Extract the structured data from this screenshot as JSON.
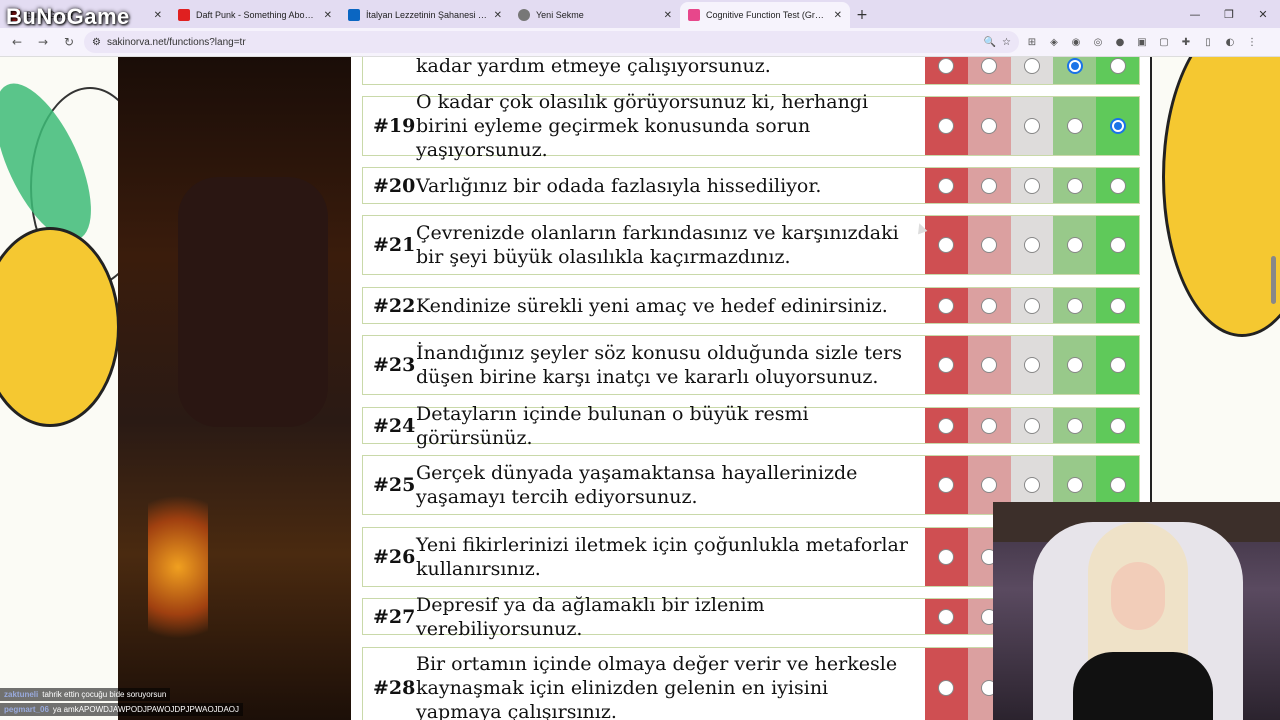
{
  "browser": {
    "tabs": [
      {
        "title": "BuNoGame",
        "favicon_color": "#e02020",
        "active": false
      },
      {
        "title": "Daft Punk - Something About Us",
        "favicon_color": "#e02020",
        "active": false
      },
      {
        "title": "İtalyan Lezzetinin Şahanesi Tiramisu",
        "favicon_color": "#0a66c2",
        "active": false
      },
      {
        "title": "Yeni Sekme",
        "favicon_color": "#777777",
        "active": false
      },
      {
        "title": "Cognitive Function Test (Grant/Bro",
        "favicon_color": "#e7478b",
        "active": true
      }
    ],
    "new_tab": "+",
    "url": "sakinorva.net/functions?lang=tr"
  },
  "overlay": {
    "logo": "BuNoGame",
    "chat": [
      {
        "user": "zaktuneli",
        "message": "tahrik ettin çocuğu bide soruyorsun"
      },
      {
        "user": "pegmart_06",
        "message": "ya amkAPOWDJAWPODJPAWOJDPJPWAOJDAOJ"
      }
    ]
  },
  "questions": [
    {
      "number": "",
      "text": "kadar yardım etmeye çalışıyorsunuz.",
      "selected": 4
    },
    {
      "number": "#19",
      "text": "O kadar çok olasılık görüyorsunuz ki, herhangi birini eyleme geçirmek konusunda sorun yaşıyorsunuz.",
      "selected": 5
    },
    {
      "number": "#20",
      "text": "Varlığınız bir odada fazlasıyla hissediliyor.",
      "selected": 0
    },
    {
      "number": "#21",
      "text": "Çevrenizde olanların farkındasınız ve karşınızdaki bir şeyi büyük olasılıkla kaçırmazdınız.",
      "selected": 0
    },
    {
      "number": "#22",
      "text": "Kendinize sürekli yeni amaç ve hedef edinirsiniz.",
      "selected": 0
    },
    {
      "number": "#23",
      "text": "İnandığınız şeyler söz konusu olduğunda sizle ters düşen birine karşı inatçı ve kararlı oluyorsunuz.",
      "selected": 0
    },
    {
      "number": "#24",
      "text": "Detayların içinde bulunan o büyük resmi görürsünüz.",
      "selected": 0
    },
    {
      "number": "#25",
      "text": "Gerçek dünyada yaşamaktansa hayallerinizde yaşamayı tercih ediyorsunuz.",
      "selected": 0
    },
    {
      "number": "#26",
      "text": "Yeni fikirlerinizi iletmek için çoğunlukla metaforlar kullanırsınız.",
      "selected": 0
    },
    {
      "number": "#27",
      "text": "Depresif ya da ağlamaklı bir izlenim verebiliyorsunuz.",
      "selected": 0
    },
    {
      "number": "#28",
      "text": "Bir ortamın içinde olmaya değer verir ve herkesle kaynaşmak için elinizden gelenin en iyisini yapmaya çalışırsınız.",
      "selected": 0
    }
  ],
  "option_colors": [
    "#cf4f52",
    "#dba0a0",
    "#dedcdb",
    "#98c98a",
    "#5fc95a"
  ]
}
